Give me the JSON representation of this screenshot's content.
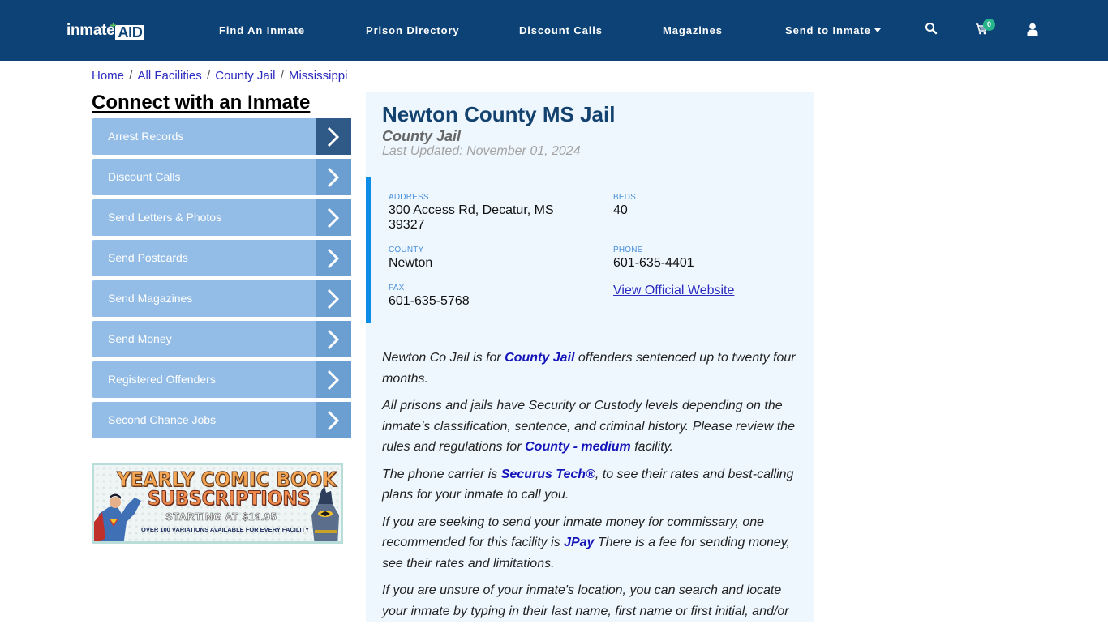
{
  "header": {
    "logo_text": "inmate",
    "logo_accent": "AID",
    "nav": [
      {
        "label": "Find An Inmate"
      },
      {
        "label": "Prison Directory"
      },
      {
        "label": "Discount Calls"
      },
      {
        "label": "Magazines"
      },
      {
        "label": "Send to Inmate",
        "has_dropdown": true
      }
    ],
    "icons": [
      "search-icon",
      "cart-icon",
      "user-icon"
    ],
    "cart_count": "0"
  },
  "breadcrumb": [
    {
      "label": "Home"
    },
    {
      "label": "All Facilities"
    },
    {
      "label": "County Jail"
    },
    {
      "label": "Mississippi"
    }
  ],
  "sidebar": {
    "title": "Connect with an Inmate",
    "items": [
      {
        "label": "Arrest Records"
      },
      {
        "label": "Discount Calls"
      },
      {
        "label": "Send Letters & Photos"
      },
      {
        "label": "Send Postcards"
      },
      {
        "label": "Send Magazines"
      },
      {
        "label": "Send Money"
      },
      {
        "label": "Registered Offenders"
      },
      {
        "label": "Second Chance Jobs"
      }
    ],
    "promo": {
      "line1": "YEARLY COMIC BOOK",
      "line2": "SUBSCRIPTIONS",
      "line3": "STARTING AT $19.95",
      "line4": "OVER 100 VARIATIONS AVAILABLE FOR EVERY FACILITY"
    }
  },
  "facility": {
    "name": "Newton County MS Jail",
    "type": "County Jail",
    "last_updated": "Last Updated: November 01, 2024",
    "address_label": "ADDRESS",
    "address_line1": "300 Access Rd, Decatur, MS",
    "address_line2": "39327",
    "beds_label": "BEDS",
    "beds": "40",
    "county_label": "COUNTY",
    "county": "Newton",
    "phone_label": "PHONE",
    "phone": "601-635-4401",
    "fax_label": "FAX",
    "fax": "601-635-5768",
    "website_link": "View Official Website"
  },
  "description": {
    "p1_a": "Newton Co Jail is for ",
    "p1_link": "County Jail",
    "p1_b": " offenders sentenced up to twenty four months.",
    "p2_a": "All prisons and jails have Security or Custody levels depending on the inmate’s classification, sentence, and criminal history. Please review the rules and regulations for ",
    "p2_link": "County - medium",
    "p2_b": " facility.",
    "p3_a": "The phone carrier is ",
    "p3_link": "Securus Tech®",
    "p3_b": ", to see their rates and best-calling plans for your inmate to call you.",
    "p4_a": "If you are seeking to send your inmate money for commissary, one recommended for this facility is ",
    "p4_link": "JPay",
    "p4_b": " There is a fee for sending money, see their rates and limitations.",
    "p5": "If you are unsure of your inmate's location, you can search and locate your inmate by typing in their last name, first name or first initial, and/or"
  },
  "colors": {
    "header_bg": "#0c4276",
    "accent_blue": "#0b8ce5",
    "menu_bg": "#93bde6",
    "link": "#1414b8"
  }
}
